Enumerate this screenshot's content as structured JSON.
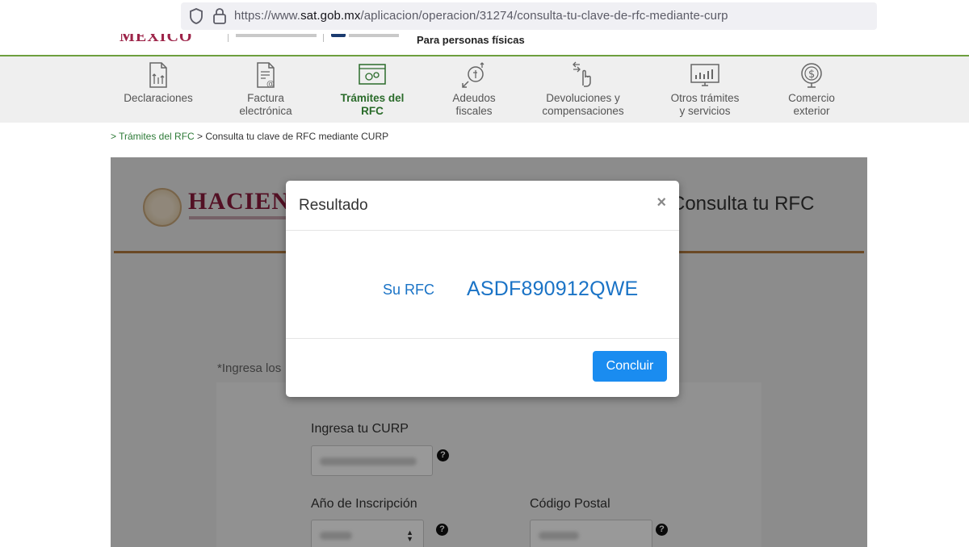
{
  "browser": {
    "url_prefix": "https://www.",
    "url_domain": "sat.gob.mx",
    "url_path": "/aplicacion/operacion/31274/consulta-tu-clave-de-rfc-mediante-curp"
  },
  "header": {
    "gov_logo_text": "MÉXICO",
    "caption": "Para personas físicas"
  },
  "nav": {
    "items": [
      {
        "label_1": "Declaraciones",
        "label_2": "",
        "icon": "declaraciones-icon"
      },
      {
        "label_1": "Factura",
        "label_2": "electrónica",
        "icon": "factura-icon"
      },
      {
        "label_1": "Trámites del",
        "label_2": "RFC",
        "icon": "tramites-rfc-icon",
        "active": true
      },
      {
        "label_1": "Adeudos",
        "label_2": "fiscales",
        "icon": "adeudos-icon"
      },
      {
        "label_1": "Devoluciones y",
        "label_2": "compensaciones",
        "icon": "devoluciones-icon"
      },
      {
        "label_1": "Otros trámites",
        "label_2": "y servicios",
        "icon": "otros-tramites-icon"
      },
      {
        "label_1": "Comercio",
        "label_2": "exterior",
        "icon": "comercio-exterior-icon"
      }
    ]
  },
  "breadcrumb": {
    "link": "> Trámites del RFC",
    "current": " > Consulta tu clave de RFC mediante CURP"
  },
  "panel": {
    "logo_text": "HACIEN",
    "title": "Consulta tu RFC",
    "hint": "*Ingresa los",
    "curp_label": "Ingresa tu CURP",
    "anio_label": "Año de Inscripción",
    "cp_label": "Código Postal",
    "help_glyph": "?"
  },
  "modal": {
    "title": "Resultado",
    "close_glyph": "×",
    "rfc_label": "Su RFC",
    "rfc_value": "ASDF890912QWE",
    "button_label": "Concluir"
  },
  "colors": {
    "brand_green": "#2a6b2a",
    "accent_blue": "#1a73c6",
    "button_blue": "#1a8cf0",
    "gov_maroon": "#9d2449"
  }
}
